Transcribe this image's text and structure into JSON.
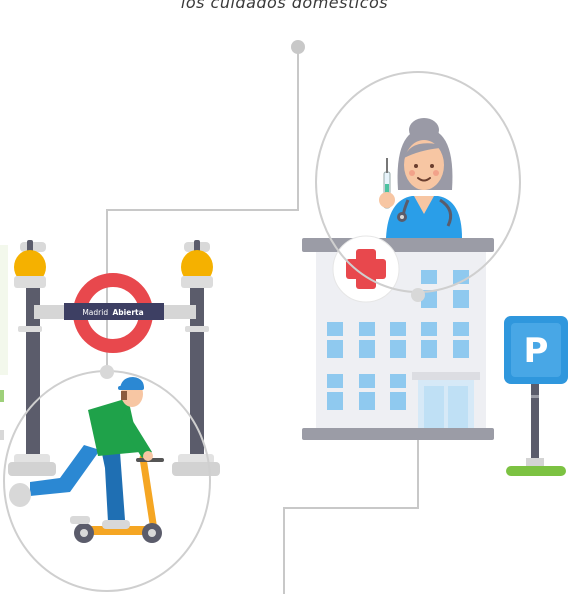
{
  "caption": "los cuidados domésticos",
  "metro_sign": {
    "word1": "Madrid",
    "word2": "Abierta"
  },
  "parking_sign": "P",
  "colors": {
    "connector_line": "#c8c8c8",
    "metro_ring": "#e8484d",
    "sign_bar": "#3d3f63",
    "lamp": "#f5b100",
    "scrubs": "#2a9ee8",
    "hospital_cross": "#e8484d",
    "parking_blue": "#2f97dd",
    "grass": "#7cc242"
  },
  "icons": [
    "metro-entrance-icon",
    "scooter-rider-icon",
    "nurse-icon",
    "hospital-icon",
    "parking-sign-icon"
  ]
}
